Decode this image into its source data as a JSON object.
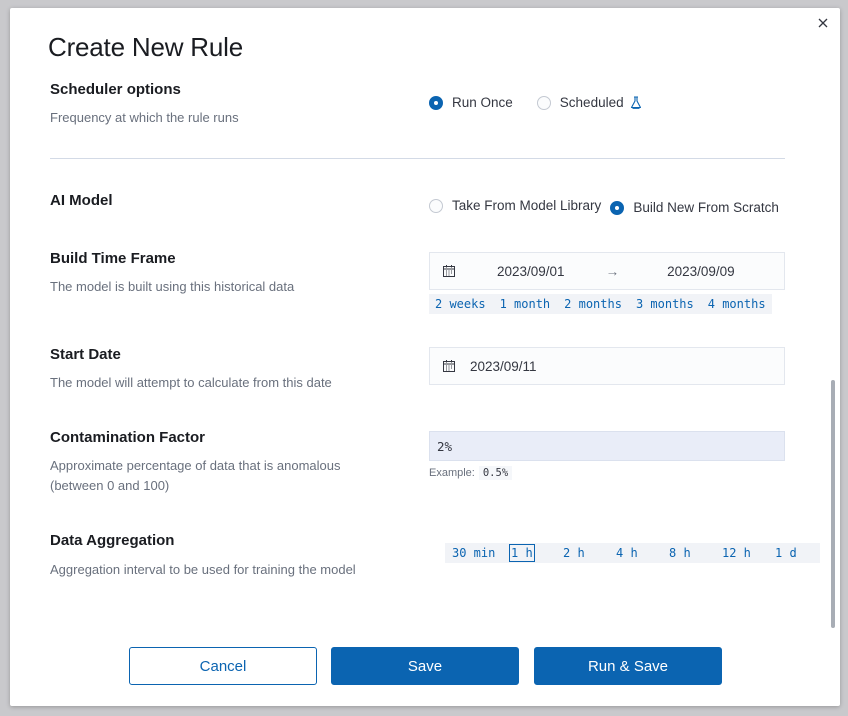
{
  "dialog": {
    "title": "Create New Rule"
  },
  "scheduler": {
    "title": "Scheduler options",
    "description": "Frequency at which the rule runs",
    "options": [
      {
        "label": "Run Once",
        "selected": true
      },
      {
        "label": "Scheduled",
        "selected": false,
        "icon": "beaker-icon"
      }
    ]
  },
  "ai_model": {
    "title": "AI Model",
    "options": [
      {
        "label": "Take From Model Library",
        "selected": false
      },
      {
        "label": "Build New From Scratch",
        "selected": true
      }
    ]
  },
  "build_time_frame": {
    "title": "Build Time Frame",
    "description": "The model is built using this historical data",
    "start": "2023/09/01",
    "end": "2023/09/09",
    "arrow": "→",
    "quick_ranges": [
      "2 weeks",
      "1 month",
      "2 months",
      "3 months",
      "4 months"
    ]
  },
  "start_date": {
    "title": "Start Date",
    "description": "The model will attempt to calculate from this date",
    "value": "2023/09/11"
  },
  "contamination": {
    "title": "Contamination Factor",
    "description": "Approximate percentage of data that is anomalous (between 0 and 100)",
    "value": "2%",
    "example_label": "Example:",
    "example_value": "0.5%"
  },
  "aggregation": {
    "title": "Data Aggregation",
    "description": "Aggregation interval to be used for training the model",
    "options": [
      "30 min",
      "1 h",
      "2 h",
      "4 h",
      "8 h",
      "12 h",
      "1 d"
    ],
    "selected": "1 h"
  },
  "footer": {
    "cancel": "Cancel",
    "save": "Save",
    "run_save": "Run & Save"
  },
  "colors": {
    "primary": "#0b64b1",
    "text": "#343741",
    "subdued": "#69707d"
  }
}
